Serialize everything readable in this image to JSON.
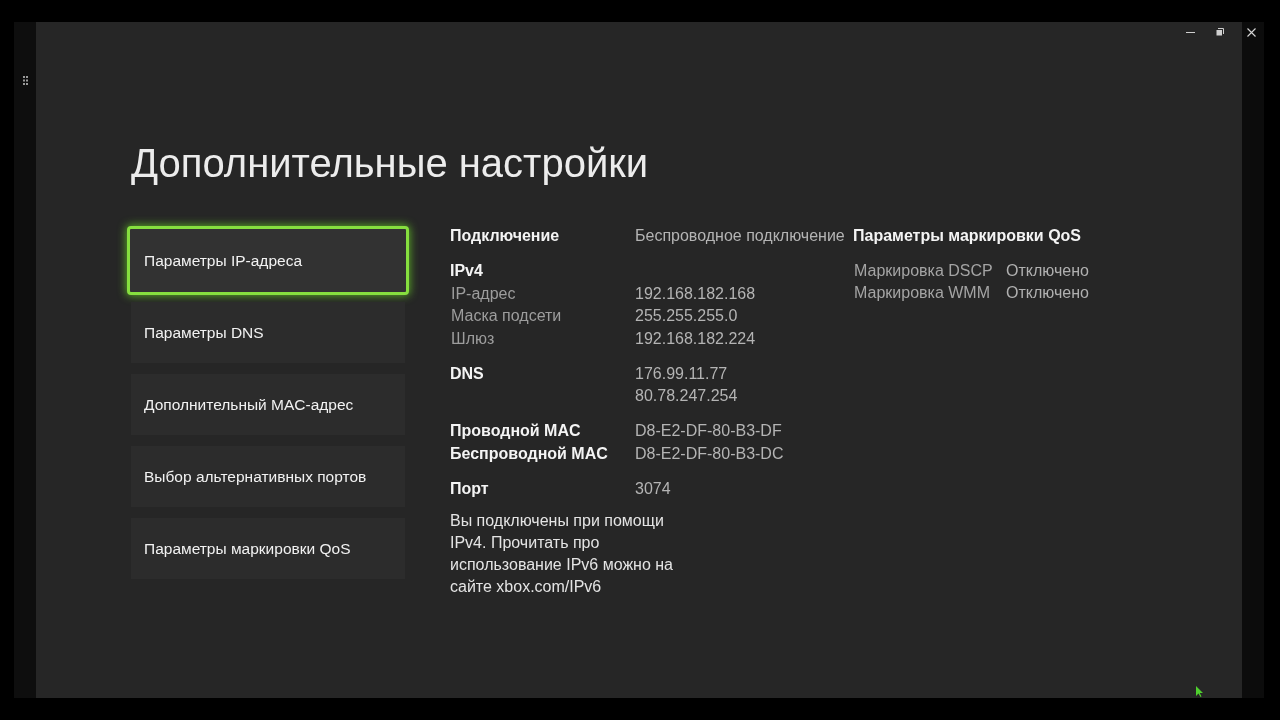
{
  "title": "Дополнительные настройки",
  "menu": [
    {
      "label": "Параметры IP-адреса",
      "selected": true
    },
    {
      "label": "Параметры DNS",
      "selected": false
    },
    {
      "label": "Дополнительный MAC-адрес",
      "selected": false
    },
    {
      "label": "Выбор альтернативных портов",
      "selected": false
    },
    {
      "label": "Параметры маркировки QoS",
      "selected": false
    }
  ],
  "details": {
    "groups": [
      {
        "items": [
          {
            "kind": "heading",
            "label": "Подключение",
            "values": [
              "Беспроводное подключение"
            ]
          }
        ]
      },
      {
        "items": [
          {
            "kind": "heading",
            "label": "IPv4"
          },
          {
            "kind": "field",
            "label": "IP-адрес",
            "values": [
              "192.168.182.168"
            ]
          },
          {
            "kind": "field",
            "label": "Маска подсети",
            "values": [
              "255.255.255.0"
            ]
          },
          {
            "kind": "field",
            "label": "Шлюз",
            "values": [
              "192.168.182.224"
            ]
          }
        ]
      },
      {
        "items": [
          {
            "kind": "heading",
            "label": "DNS",
            "values": [
              "176.99.11.77",
              "80.78.247.254"
            ]
          }
        ]
      },
      {
        "items": [
          {
            "kind": "heading",
            "label": "Проводной MAC",
            "values": [
              "D8-E2-DF-80-B3-DF"
            ]
          },
          {
            "kind": "heading",
            "label": "Беспроводной MAC",
            "values": [
              "D8-E2-DF-80-B3-DC"
            ]
          }
        ]
      },
      {
        "items": [
          {
            "kind": "heading",
            "label": "Порт",
            "values": [
              "3074"
            ]
          }
        ]
      }
    ],
    "note": "Вы подключены при помощи IPv4. Прочитать про использование IPv6 можно на сайте xbox.com/IPv6"
  },
  "qos": {
    "heading": "Параметры маркировки QoS",
    "rows": [
      {
        "label": "Маркировка DSCP",
        "value": "Отключено"
      },
      {
        "label": "Маркировка WMM",
        "value": "Отключено"
      }
    ]
  }
}
